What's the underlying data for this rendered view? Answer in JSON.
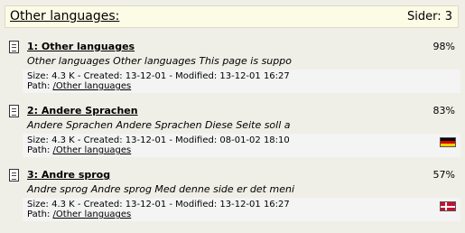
{
  "header": {
    "title": "Other languages:",
    "pages": "Sider: 3"
  },
  "results": [
    {
      "title": "1: Other languages",
      "score": "98%",
      "snippet": "Other languages Other languages This page is suppo",
      "meta": "Size: 4.3 K - Created: 13-12-01 - Modified: 13-12-01 16:27",
      "path_label": "Path:",
      "path": "/Other languages",
      "flag": "none"
    },
    {
      "title": "2: Andere Sprachen",
      "score": "83%",
      "snippet": "Andere Sprachen Andere Sprachen Diese Seite soll a",
      "meta": "Size: 4.3 K - Created: 13-12-01 - Modified: 08-01-02 18:10",
      "path_label": "Path:",
      "path": "/Other languages",
      "flag": "germany-flag"
    },
    {
      "title": "3: Andre sprog",
      "score": "57%",
      "snippet": "Andre sprog Andre sprog Med denne side er det meni",
      "meta": "Size: 4.3 K - Created: 13-12-01 - Modified: 13-12-01 16:27",
      "path_label": "Path:",
      "path": "/Other languages",
      "flag": "denmark-flag"
    }
  ]
}
